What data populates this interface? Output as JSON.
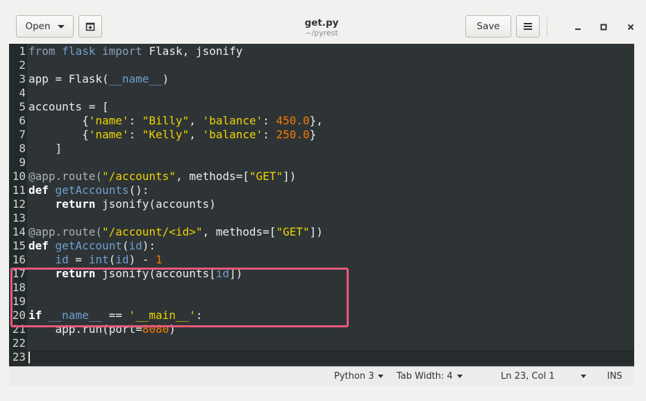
{
  "header": {
    "open_label": "Open",
    "title": "get.py",
    "subtitle": "~/pyrest",
    "save_label": "Save"
  },
  "icons": {
    "open_menu": "chevron-down-icon",
    "new_tab": "new-document-icon",
    "menu": "hamburger-menu-icon",
    "minimize": "minimize-icon",
    "maximize": "maximize-icon",
    "close": "close-icon"
  },
  "editor": {
    "current_line": 23,
    "highlighted_lines": [
      14,
      17
    ],
    "lines": [
      {
        "n": "1",
        "tokens": [
          {
            "t": "from",
            "c": "kw-soft"
          },
          {
            "t": " "
          },
          {
            "t": "flask",
            "c": "id"
          },
          {
            "t": " "
          },
          {
            "t": "import",
            "c": "kw-soft"
          },
          {
            "t": " Flask, jsonify"
          }
        ]
      },
      {
        "n": "2",
        "tokens": []
      },
      {
        "n": "3",
        "tokens": [
          {
            "t": "app = Flask("
          },
          {
            "t": "__name__",
            "c": "id"
          },
          {
            "t": ")"
          }
        ]
      },
      {
        "n": "4",
        "tokens": []
      },
      {
        "n": "5",
        "tokens": [
          {
            "t": "accounts = ["
          }
        ]
      },
      {
        "n": "6",
        "tokens": [
          {
            "t": "        {"
          },
          {
            "t": "'name'",
            "c": "str"
          },
          {
            "t": ": "
          },
          {
            "t": "\"Billy\"",
            "c": "str"
          },
          {
            "t": ", "
          },
          {
            "t": "'balance'",
            "c": "str"
          },
          {
            "t": ": "
          },
          {
            "t": "450.0",
            "c": "num"
          },
          {
            "t": "},"
          }
        ]
      },
      {
        "n": "7",
        "tokens": [
          {
            "t": "        {"
          },
          {
            "t": "'name'",
            "c": "str"
          },
          {
            "t": ": "
          },
          {
            "t": "\"Kelly\"",
            "c": "str"
          },
          {
            "t": ", "
          },
          {
            "t": "'balance'",
            "c": "str"
          },
          {
            "t": ": "
          },
          {
            "t": "250.0",
            "c": "num"
          },
          {
            "t": "}"
          }
        ]
      },
      {
        "n": "8",
        "tokens": [
          {
            "t": "    ]"
          }
        ]
      },
      {
        "n": "9",
        "tokens": []
      },
      {
        "n": "10",
        "tokens": [
          {
            "t": "@app.route(",
            "c": "dec"
          },
          {
            "t": "\"/accounts\"",
            "c": "str"
          },
          {
            "t": ", methods=["
          },
          {
            "t": "\"GET\"",
            "c": "str"
          },
          {
            "t": "])"
          }
        ]
      },
      {
        "n": "11",
        "tokens": [
          {
            "t": "def",
            "c": "kw"
          },
          {
            "t": " "
          },
          {
            "t": "getAccounts",
            "c": "id"
          },
          {
            "t": "():"
          }
        ]
      },
      {
        "n": "12",
        "tokens": [
          {
            "t": "    "
          },
          {
            "t": "return",
            "c": "kw"
          },
          {
            "t": " jsonify(accounts)"
          }
        ]
      },
      {
        "n": "13",
        "tokens": []
      },
      {
        "n": "14",
        "tokens": [
          {
            "t": "@app.route(",
            "c": "dec"
          },
          {
            "t": "\"/account/<id>\"",
            "c": "str"
          },
          {
            "t": ", methods=["
          },
          {
            "t": "\"GET\"",
            "c": "str"
          },
          {
            "t": "])"
          }
        ]
      },
      {
        "n": "15",
        "tokens": [
          {
            "t": "def",
            "c": "kw"
          },
          {
            "t": " "
          },
          {
            "t": "getAccount",
            "c": "id"
          },
          {
            "t": "("
          },
          {
            "t": "id",
            "c": "id"
          },
          {
            "t": "):"
          }
        ]
      },
      {
        "n": "16",
        "tokens": [
          {
            "t": "    "
          },
          {
            "t": "id",
            "c": "id"
          },
          {
            "t": " = "
          },
          {
            "t": "int",
            "c": "id"
          },
          {
            "t": "("
          },
          {
            "t": "id",
            "c": "id"
          },
          {
            "t": ") - "
          },
          {
            "t": "1",
            "c": "num"
          }
        ]
      },
      {
        "n": "17",
        "tokens": [
          {
            "t": "    "
          },
          {
            "t": "return",
            "c": "kw"
          },
          {
            "t": " jsonify(accounts["
          },
          {
            "t": "id",
            "c": "id"
          },
          {
            "t": "])"
          }
        ]
      },
      {
        "n": "18",
        "tokens": []
      },
      {
        "n": "19",
        "tokens": []
      },
      {
        "n": "20",
        "tokens": [
          {
            "t": "if",
            "c": "kw"
          },
          {
            "t": " "
          },
          {
            "t": "__name__",
            "c": "id"
          },
          {
            "t": " == "
          },
          {
            "t": "'__main__'",
            "c": "str"
          },
          {
            "t": ":"
          }
        ]
      },
      {
        "n": "21",
        "tokens": [
          {
            "t": "    app.run(port="
          },
          {
            "t": "8080",
            "c": "num"
          },
          {
            "t": ")"
          }
        ]
      },
      {
        "n": "22",
        "tokens": []
      },
      {
        "n": "23",
        "tokens": []
      }
    ]
  },
  "statusbar": {
    "language": "Python 3",
    "tab_width": "Tab Width: 4",
    "position": "Ln 23, Col 1",
    "mode": "INS"
  }
}
